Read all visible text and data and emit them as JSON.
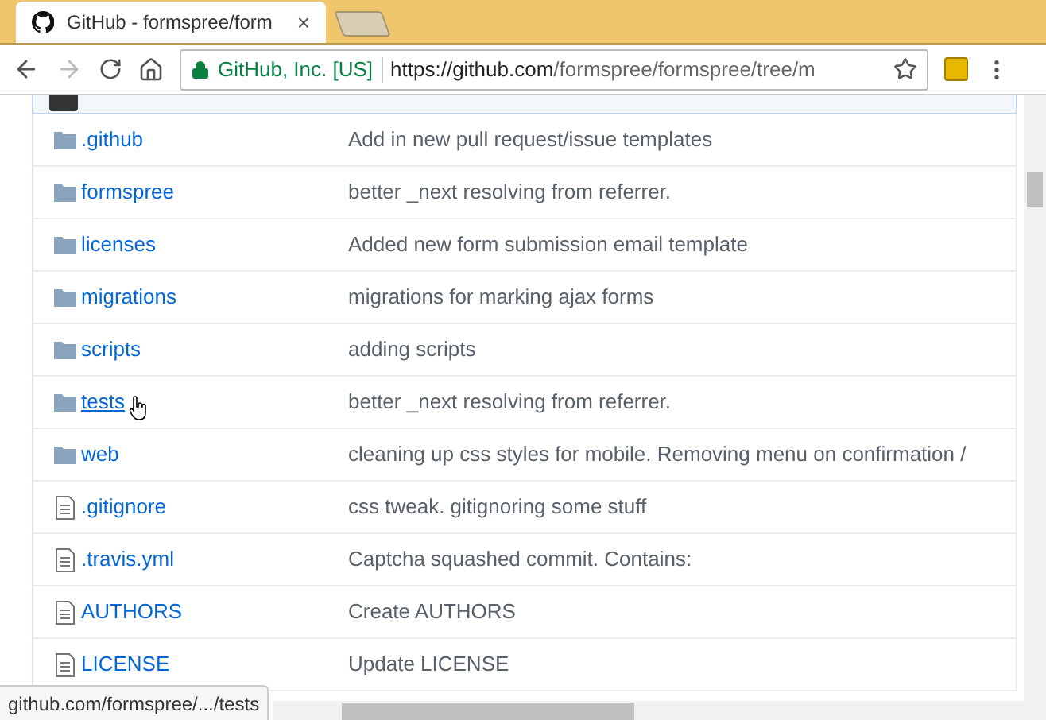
{
  "tab": {
    "title": "GitHub - formspree/form",
    "close": "×"
  },
  "address": {
    "owner": "GitHub, Inc. [US]",
    "url_host": "https://github.com",
    "url_path": "/formspree/formspree/tree/m"
  },
  "files": [
    {
      "kind": "folder",
      "name": ".github",
      "message": "Add in new pull request/issue templates",
      "hovered": false
    },
    {
      "kind": "folder",
      "name": "formspree",
      "message": "better _next resolving from referrer.",
      "hovered": false
    },
    {
      "kind": "folder",
      "name": "licenses",
      "message": "Added new form submission email template",
      "hovered": false
    },
    {
      "kind": "folder",
      "name": "migrations",
      "message": "migrations for marking ajax forms",
      "hovered": false
    },
    {
      "kind": "folder",
      "name": "scripts",
      "message": "adding scripts",
      "hovered": false
    },
    {
      "kind": "folder",
      "name": "tests",
      "message": "better _next resolving from referrer.",
      "hovered": true
    },
    {
      "kind": "folder",
      "name": "web",
      "message": "cleaning up css styles for mobile. Removing menu on confirmation /",
      "hovered": false
    },
    {
      "kind": "file",
      "name": ".gitignore",
      "message": "css tweak. gitignoring some stuff",
      "hovered": false
    },
    {
      "kind": "file",
      "name": ".travis.yml",
      "message": "Captcha squashed commit. Contains:",
      "hovered": false
    },
    {
      "kind": "file",
      "name": "AUTHORS",
      "message": "Create AUTHORS",
      "hovered": false
    },
    {
      "kind": "file",
      "name": "LICENSE",
      "message": "Update LICENSE",
      "hovered": false
    }
  ],
  "status_bar": "github.com/formspree/.../tests"
}
